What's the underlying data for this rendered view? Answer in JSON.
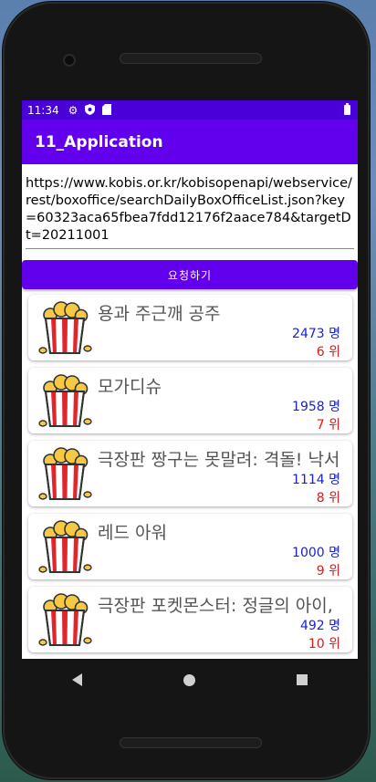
{
  "status_bar": {
    "time": "11:34",
    "icons": [
      "gear-icon",
      "shield-icon",
      "sd-card-icon",
      "battery-icon"
    ]
  },
  "app": {
    "title": "11_Application",
    "accent": "#6200ee",
    "status_color": "#4a00d8"
  },
  "request": {
    "url": "https://www.kobis.or.kr/kobisopenapi/webservice/rest/boxoffice/searchDailyBoxOfficeList.json?key=60323aca65fbea7fdd12176f2aace784&targetDt=20211001",
    "button_label": "요청하기"
  },
  "movies": [
    {
      "title": "용과 주근깨 공주",
      "audience": "2473 명",
      "rank": "6 위"
    },
    {
      "title": "모가디슈",
      "audience": "1958 명",
      "rank": "7 위"
    },
    {
      "title": "극장판 짱구는 못말려: 격돌! 낙서",
      "audience": "1114 명",
      "rank": "8 위"
    },
    {
      "title": "레드 아워",
      "audience": "1000 명",
      "rank": "9 위"
    },
    {
      "title": "극장판 포켓몬스터: 정글의 아이,",
      "audience": "492 명",
      "rank": "10 위"
    }
  ],
  "colors": {
    "audience": "#1a23c9",
    "rank": "#e01818"
  }
}
